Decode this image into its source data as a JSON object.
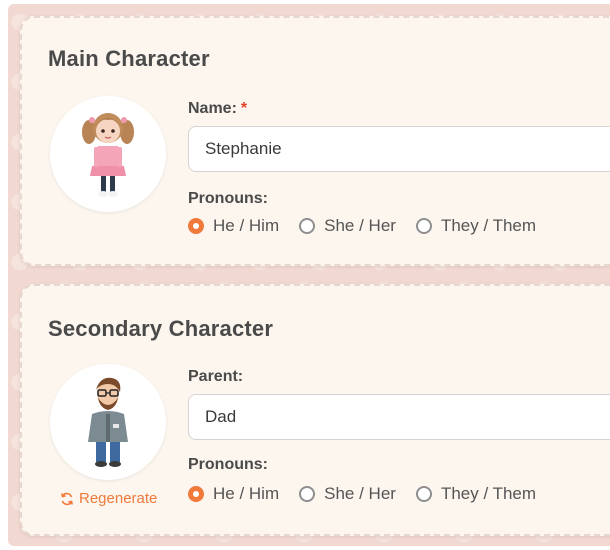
{
  "main_character": {
    "title": "Main Character",
    "name_label": "Name:",
    "required_mark": "*",
    "name_value": "Stephanie",
    "pronouns_label": "Pronouns:",
    "pronoun_options": [
      "He / Him",
      "She / Her",
      "They / Them"
    ],
    "selected_pronoun": "He / Him"
  },
  "secondary_character": {
    "title": "Secondary Character",
    "parent_label": "Parent:",
    "parent_value": "Dad",
    "pronouns_label": "Pronouns:",
    "pronoun_options": [
      "He / Him",
      "She / Her",
      "They / Them"
    ],
    "selected_pronoun": "He / Him",
    "regenerate_label": "Regenerate"
  },
  "colors": {
    "accent": "#ef7a3c",
    "required": "#e0452a",
    "card_bg": "#fcf6ef"
  },
  "icons": {
    "regenerate": "refresh-icon",
    "avatar_main": "girl-avatar",
    "avatar_secondary": "man-avatar"
  }
}
